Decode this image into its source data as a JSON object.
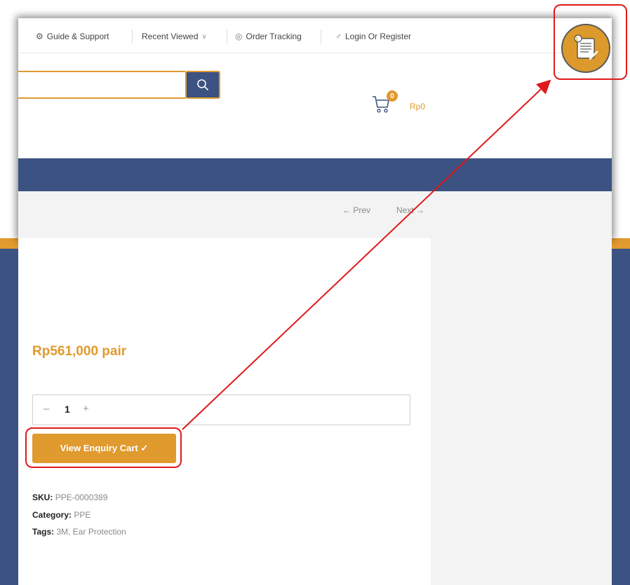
{
  "header": {
    "links": [
      {
        "label": "Guide & Support",
        "icon": "gear-icon"
      },
      {
        "label": "Recent Viewed",
        "icon": "chevron-down-icon"
      },
      {
        "label": "Order Tracking",
        "icon": "target-icon"
      },
      {
        "label": "Login Or Register",
        "icon": "user-icon"
      }
    ]
  },
  "cart": {
    "count": "0",
    "amount": "Rp0"
  },
  "pager": {
    "prev": "← Prev",
    "next": "Next →"
  },
  "product": {
    "price": "Rp561,000 pair",
    "quantity": "1",
    "minus": "–",
    "plus": "+",
    "cta_label": "View Enquiry Cart ✓",
    "sku_label": "SKU:",
    "sku": "PPE-0000389",
    "category_label": "Category:",
    "category": "PPE",
    "tags_label": "Tags:",
    "tags": "3M, Ear Protection"
  },
  "float_button": {
    "badge": "1",
    "icon": "enquiry-list-icon"
  },
  "colors": {
    "accent": "#e09a2e",
    "navy": "#3b5282",
    "highlight": "#e0191b"
  }
}
